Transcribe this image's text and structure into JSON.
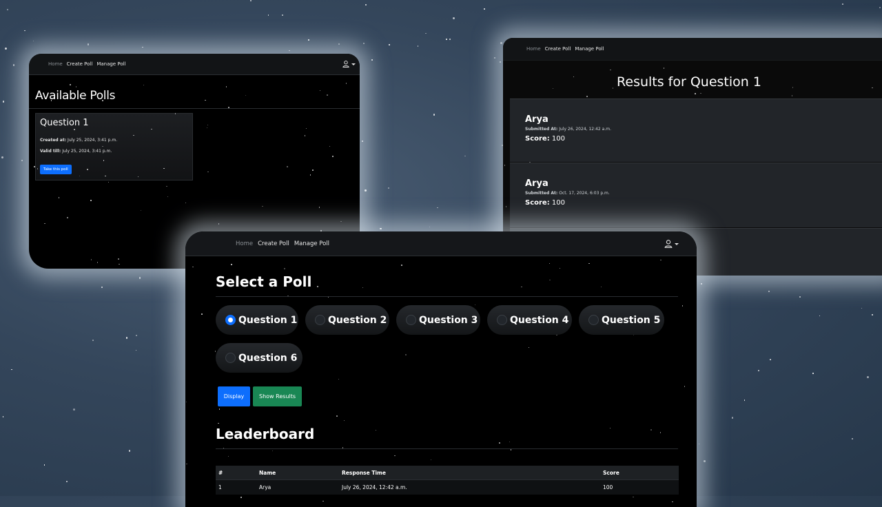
{
  "nav": {
    "home": "Home",
    "create": "Create Poll",
    "manage": "Manage Poll"
  },
  "available": {
    "title": "Available Polls",
    "card": {
      "title": "Question 1",
      "created_label": "Created at:",
      "created_value": "July 25, 2024, 3:41 p.m.",
      "valid_label": "Valid till:",
      "valid_value": "July 25, 2024, 3:41 p.m.",
      "button": "Take this poll"
    }
  },
  "results": {
    "title": "Results for Question 1",
    "items": [
      {
        "name": "Arya",
        "submitted_label": "Submitted At:",
        "submitted_value": "July 26, 2024, 12:42 a.m.",
        "score_label": "Score:",
        "score_value": "100"
      },
      {
        "name": "Arya",
        "submitted_label": "Submitted At:",
        "submitted_value": "Oct. 17, 2024, 6:03 p.m.",
        "score_label": "Score:",
        "score_value": "100"
      }
    ]
  },
  "select": {
    "title": "Select a Poll",
    "options": [
      {
        "label": "Question 1",
        "checked": true
      },
      {
        "label": "Question 2",
        "checked": false
      },
      {
        "label": "Question 3",
        "checked": false
      },
      {
        "label": "Question 4",
        "checked": false
      },
      {
        "label": "Question 5",
        "checked": false
      },
      {
        "label": "Question 6",
        "checked": false
      }
    ],
    "display_button": "Display",
    "results_button": "Show Results"
  },
  "leaderboard": {
    "title": "Leaderboard",
    "columns": [
      "#",
      "Name",
      "Response Time",
      "Score"
    ],
    "rows": [
      [
        "1",
        "Arya",
        "July 26, 2024, 12:42 a.m.",
        "100"
      ]
    ]
  },
  "colors": {
    "primary": "#0d6efd",
    "success": "#198754",
    "window_bg": "#000000"
  }
}
